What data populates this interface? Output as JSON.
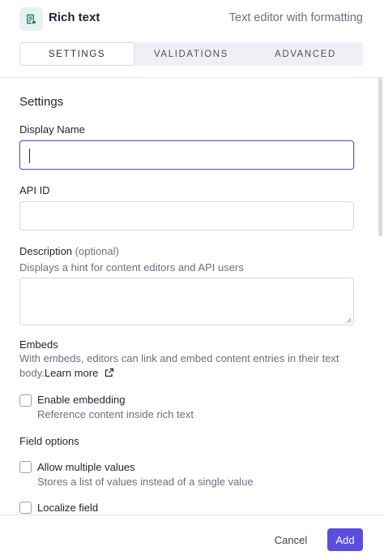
{
  "header": {
    "icon": "rich-text-icon",
    "title": "Rich text",
    "subtitle": "Text editor with formatting"
  },
  "tabs": [
    {
      "label": "SETTINGS",
      "active": true
    },
    {
      "label": "VALIDATIONS",
      "active": false
    },
    {
      "label": "ADVANCED",
      "active": false
    }
  ],
  "settings": {
    "section_title": "Settings",
    "display_name": {
      "label": "Display Name",
      "value": ""
    },
    "api_id": {
      "label": "API ID",
      "value": ""
    },
    "description": {
      "label": "Description",
      "optional": "(optional)",
      "hint": "Displays a hint for content editors and API users",
      "value": ""
    }
  },
  "embeds": {
    "title": "Embeds",
    "text": "With embeds, editors can link and embed content entries in their text body.",
    "link": "Learn more",
    "link_icon": "external-link-icon",
    "enable": {
      "label": "Enable embedding",
      "hint": "Reference content inside rich text",
      "checked": false
    }
  },
  "field_options": {
    "title": "Field options",
    "allow_multiple": {
      "label": "Allow multiple values",
      "hint": "Stores a list of values instead of a single value",
      "checked": false
    },
    "localize": {
      "label": "Localize field",
      "checked": false
    }
  },
  "footer": {
    "cancel": "Cancel",
    "add": "Add"
  },
  "colors": {
    "accent": "#5b4ede",
    "icon_bg": "#e4f3f0",
    "icon_fg": "#1f6f6a",
    "focus": "#6657d6"
  }
}
